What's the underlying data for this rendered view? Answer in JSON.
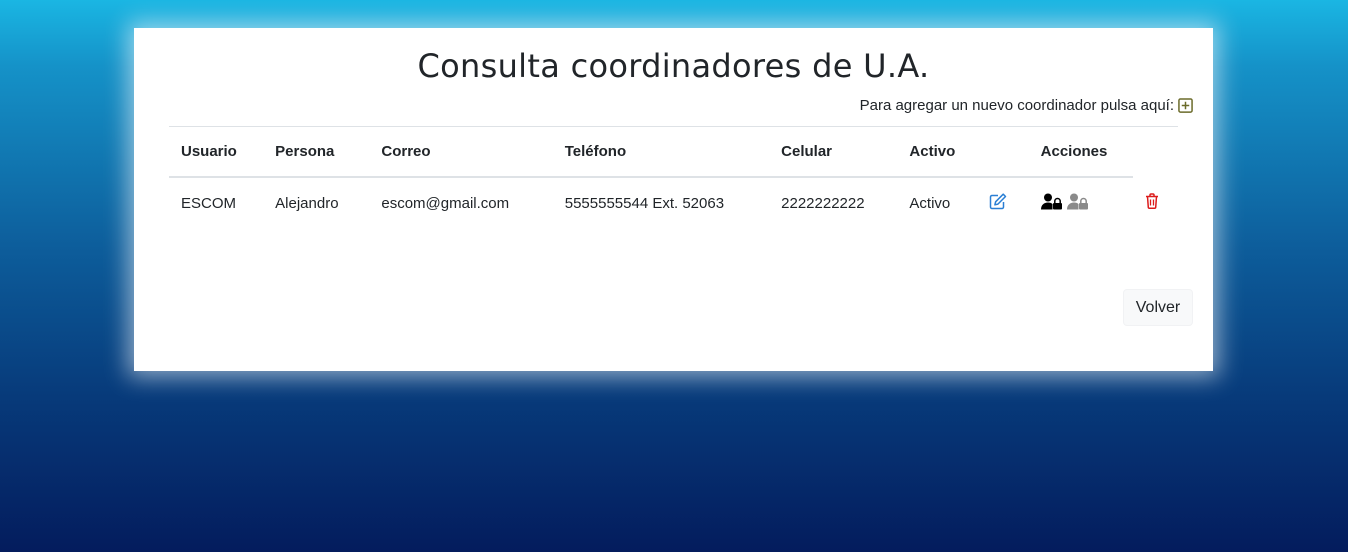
{
  "page": {
    "title": "Consulta coordinadores de U.A.",
    "add_hint": "Para agregar un nuevo coordinador pulsa aquí:"
  },
  "table": {
    "headers": [
      "Usuario",
      "Persona",
      "Correo",
      "Teléfono",
      "Celular",
      "Activo",
      "",
      "Acciones",
      ""
    ],
    "rows": [
      {
        "usuario": "ESCOM",
        "persona": "Alejandro",
        "correo": "escom@gmail.com",
        "telefono": "5555555544 Ext. 52063",
        "celular": "2222222222",
        "activo": "Activo",
        "actions": {
          "edit_icon": "edit-icon",
          "lock_user_icon": "user-lock-icon",
          "unlock_user_icon": "user-lock-disabled-icon",
          "delete_icon": "trash-icon"
        }
      }
    ]
  },
  "footer": {
    "back_label": "Volver"
  },
  "colors": {
    "add_icon": "#6b6b2a",
    "edit_icon": "#2a7fd4",
    "delete_icon": "#dc1b1b",
    "lock_active": "#000000",
    "lock_inactive": "#8a8a8a",
    "button_bg": "#f8f9fa"
  }
}
